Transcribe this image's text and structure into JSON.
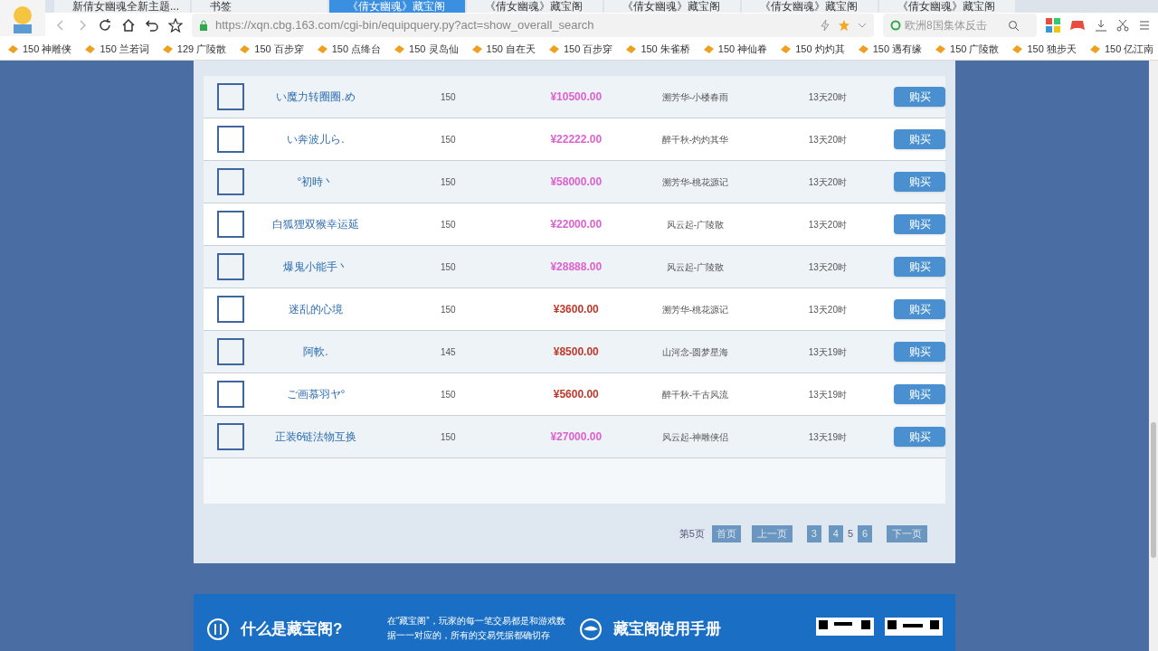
{
  "browser": {
    "tabs": [
      {
        "title": "新倩女幽魂全新主题...",
        "selected": false
      },
      {
        "title": "书签",
        "selected": false
      },
      {
        "title": "《倩女幽魂》藏宝阁",
        "selected": true
      },
      {
        "title": "《倩女幽魂》藏宝阁",
        "selected": false
      },
      {
        "title": "《倩女幽魂》藏宝阁",
        "selected": false
      },
      {
        "title": "《倩女幽魂》藏宝阁",
        "selected": false
      },
      {
        "title": "《倩女幽魂》藏宝阁",
        "selected": false
      }
    ],
    "url": "https://xqn.cbg.163.com/cgi-bin/equipquery.py?act=show_overall_search",
    "search": {
      "placeholder": "欧洲8国集体反击"
    },
    "bookmarks": [
      "150 神雕侠",
      "150 兰若词",
      "129 广陵散",
      "150 百步穿",
      "150 点绛台",
      "150 灵岛仙",
      "150 自在天",
      "150 百步穿",
      "150 朱雀桥",
      "150 神仙眷",
      "150 灼灼其",
      "150 遇有缘",
      "150 广陵散",
      "150 独步天",
      "150 亿江南"
    ]
  },
  "listings": [
    {
      "name": "い魔力转圈圈.め",
      "level": "150",
      "price": "¥10500.00",
      "color": "#e060d0",
      "server": "溯芳华-小楼春雨",
      "time": "13天20时",
      "button": "购买"
    },
    {
      "name": "い奔波儿ら.",
      "level": "150",
      "price": "¥22222.00",
      "color": "#e060d0",
      "server": "醉千秋-灼灼其华",
      "time": "13天20时",
      "button": "购买"
    },
    {
      "name": "°初時丶",
      "level": "150",
      "price": "¥58000.00",
      "color": "#e060d0",
      "server": "溯芳华-桃花源记",
      "time": "13天20时",
      "button": "购买"
    },
    {
      "name": "白狐狸双猴幸运延",
      "level": "150",
      "price": "¥22000.00",
      "color": "#e060d0",
      "server": "风云起-广陵散",
      "time": "13天20时",
      "button": "购买"
    },
    {
      "name": "爆鬼小能手丶",
      "level": "150",
      "price": "¥28888.00",
      "color": "#e060d0",
      "server": "风云起-广陵散",
      "time": "13天20时",
      "button": "购买"
    },
    {
      "name": "迷乱的心境",
      "level": "150",
      "price": "¥3600.00",
      "color": "#c0392b",
      "server": "溯芳华-桃花源记",
      "time": "13天20时",
      "button": "购买"
    },
    {
      "name": "阿軟.",
      "level": "145",
      "price": "¥8500.00",
      "color": "#c0392b",
      "server": "山河念-圆梦星海",
      "time": "13天19时",
      "button": "购买"
    },
    {
      "name": "ご画慕羽ヤ°",
      "level": "150",
      "price": "¥5600.00",
      "color": "#c0392b",
      "server": "醉千秋-千古风流",
      "time": "13天19时",
      "button": "购买"
    },
    {
      "name": "正装6链法物互换",
      "level": "150",
      "price": "¥27000.00",
      "color": "#e060d0",
      "server": "风云起-神雕侠侣",
      "time": "13天19时",
      "button": "购买"
    }
  ],
  "pagination": {
    "current": "第5页",
    "first": "首页",
    "prev": "上一页",
    "pages": [
      {
        "label": "3",
        "selected": false
      },
      {
        "label": "4",
        "selected": false
      },
      {
        "label": "5",
        "selected": true
      },
      {
        "label": "6",
        "selected": false
      }
    ],
    "next": "下一页"
  },
  "footer": {
    "title_1": "什么是藏宝阁?",
    "text": "在“藏宝阁”，玩家的每一笔交易都是和游戏数据一一对应的，所有的交易凭据都确切存",
    "title_2": "藏宝阁使用手册"
  }
}
